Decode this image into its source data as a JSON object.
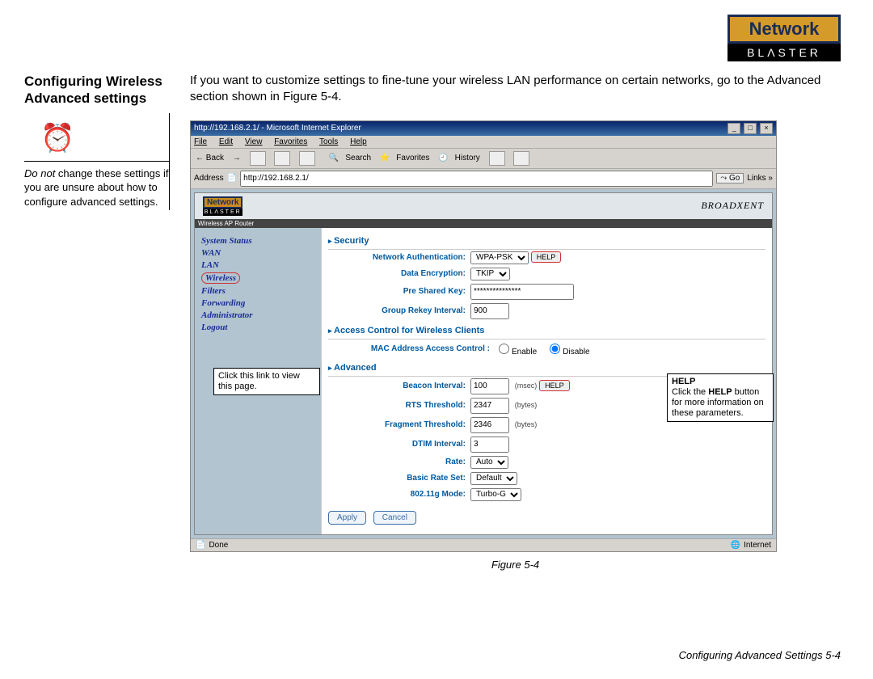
{
  "brand": {
    "top": "Network",
    "bottom": "BLΛSTER"
  },
  "heading": "Configuring Wireless Advanced settings",
  "intro": "If you want to customize settings to fine-tune your wireless LAN performance on certain networks, go to the Advanced section shown in Figure 5-4.",
  "warning_prefix": "Do not",
  "warning_rest": " change these settings if you are unsure about how to configure advanced settings.",
  "browser": {
    "title": "http://192.168.2.1/ - Microsoft Internet Explorer",
    "menubar": [
      "File",
      "Edit",
      "View",
      "Favorites",
      "Tools",
      "Help"
    ],
    "toolbar": {
      "back": "← Back",
      "forward": "→",
      "search": "Search",
      "favorites": "Favorites",
      "history": "History"
    },
    "address_label": "Address",
    "address_value": "http://192.168.2.1/",
    "go_label": "Go",
    "links_label": "Links »",
    "status_left": "Done",
    "status_right": "Internet"
  },
  "router": {
    "vendor": "BROADXENT",
    "subheader": "Wireless AP Router",
    "nav": [
      "System Status",
      "WAN",
      "LAN",
      "Wireless",
      "Filters",
      "Forwarding",
      "Administrator",
      "Logout"
    ],
    "sections": {
      "security": {
        "title": "Security",
        "auth_label": "Network Authentication:",
        "auth_value": "WPA-PSK",
        "enc_label": "Data Encryption:",
        "enc_value": "TKIP",
        "psk_label": "Pre Shared Key:",
        "psk_value": "***************",
        "rekey_label": "Group Rekey Interval:",
        "rekey_value": "900",
        "help": "HELP"
      },
      "acl": {
        "title": "Access Control for Wireless Clients",
        "mac_label": "MAC Address Access Control :",
        "enable": "Enable",
        "disable": "Disable"
      },
      "advanced": {
        "title": "Advanced",
        "beacon_label": "Beacon Interval:",
        "beacon_value": "100",
        "beacon_unit": "(msec)",
        "rts_label": "RTS Threshold:",
        "rts_value": "2347",
        "rts_unit": "(bytes)",
        "frag_label": "Fragment Threshold:",
        "frag_value": "2346",
        "frag_unit": "(bytes)",
        "dtim_label": "DTIM Interval:",
        "dtim_value": "3",
        "rate_label": "Rate:",
        "rate_value": "Auto",
        "brs_label": "Basic Rate Set:",
        "brs_value": "Default",
        "mode_label": "802.11g Mode:",
        "mode_value": "Turbo-G",
        "help": "HELP",
        "apply": "Apply",
        "cancel": "Cancel"
      }
    }
  },
  "callouts": {
    "nav_hint": "Click this link to view this page.",
    "help_title": "HELP",
    "help_prefix": "Click the ",
    "help_word": "HELP",
    "help_rest": " button for more information on these parameters."
  },
  "figure_caption": "Figure 5-4",
  "footer": "Configuring Advanced Settings  5-4"
}
